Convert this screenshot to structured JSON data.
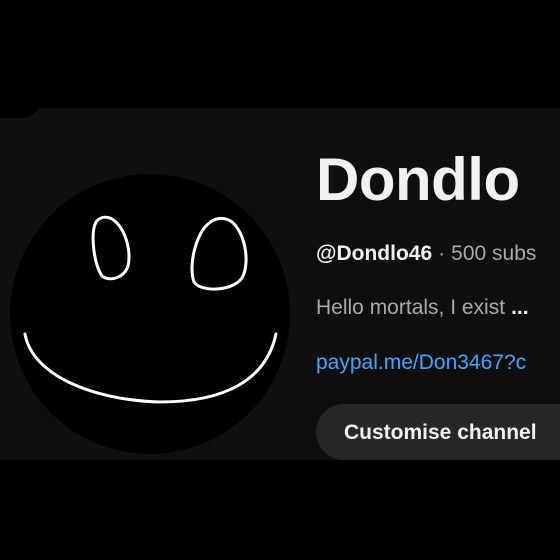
{
  "colors": {
    "page_background": "#0f0f0f",
    "outer_background": "#000000",
    "primary_text": "#f1f1f1",
    "secondary_text": "#aaaaaa",
    "link": "#3ea6ff",
    "button_background": "#272727"
  },
  "channel": {
    "name": "Dondlo",
    "handle": "@Dondlo46",
    "separator": "·",
    "subscribers": "500 subs",
    "description": "Hello mortals, I exist",
    "more_label": "...",
    "link": "paypal.me/Don3467?c",
    "avatar_icon": "smiley-face-icon"
  },
  "actions": {
    "customise_label": "Customise channel"
  }
}
